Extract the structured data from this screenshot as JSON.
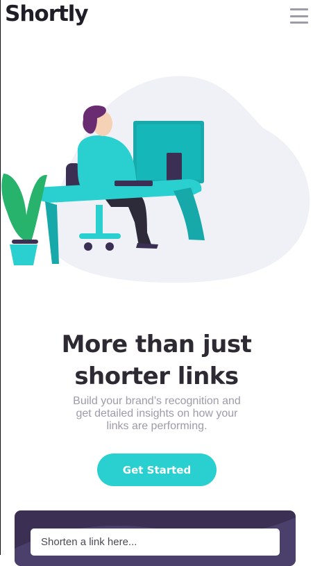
{
  "header": {
    "logo_text": "Shortly",
    "menu_icon": "hamburger-icon"
  },
  "hero": {
    "illustration": "person-working-at-desk-illustration",
    "title_line1": "More than just",
    "title_line2": "shorter links",
    "subtitle": "Build your brand’s recognition and get detailed insights on how your links are performing.",
    "cta_label": "Get Started"
  },
  "shorten": {
    "placeholder": "Shorten a link here..."
  },
  "colors": {
    "primary": "#2acfcf",
    "dark_violet": "#3b3054",
    "text_dark": "#34313d",
    "text_gray": "#9e9aa8",
    "blob": "#eff1f7"
  }
}
